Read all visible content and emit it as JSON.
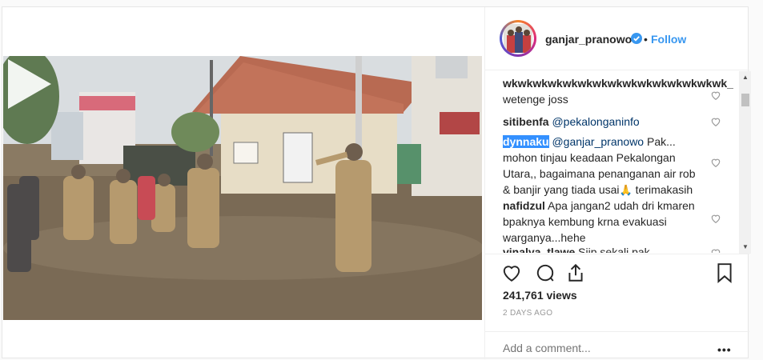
{
  "post": {
    "username": "ganjar_pranowo",
    "follow_label": "Follow",
    "separator": "•",
    "views": "241,761 views",
    "date": "2 DAYS AGO",
    "add_comment_placeholder": "Add a comment...",
    "more_label": "•••",
    "video_playing": false
  },
  "comments": [
    {
      "user": "wkwkwkwkwkwkwkwkwkwkwkwkwkwkwk_",
      "text": "wetenge joss"
    },
    {
      "user": "sitibenfa",
      "mention": "@pekalonganinfo",
      "text": ""
    },
    {
      "user": "dynnaku",
      "mention": "@ganjar_pranowo",
      "lines": [
        "Pak...",
        "mohon tinjau keadaan Pekalongan",
        "Utara,, bagaimana penanganan air rob",
        "& banjir yang tiada usai",
        "terimakasih"
      ]
    },
    {
      "user": "nafidzul",
      "lines": [
        "Apa jangan2 udah dri kmaren",
        "bpaknya kembung krna evakuasi",
        "warganya...hehe"
      ]
    },
    {
      "user": "vinalya_tlawe",
      "text": "Siip sekali pak"
    }
  ],
  "colors": {
    "link": "#3897f0",
    "verified": "#3897f0",
    "highlight": "#3390ff"
  },
  "icons": [
    "verified-badge-icon",
    "heart-icon",
    "comment-icon",
    "share-icon",
    "bookmark-icon",
    "play-icon",
    "pray-emoji-icon"
  ]
}
